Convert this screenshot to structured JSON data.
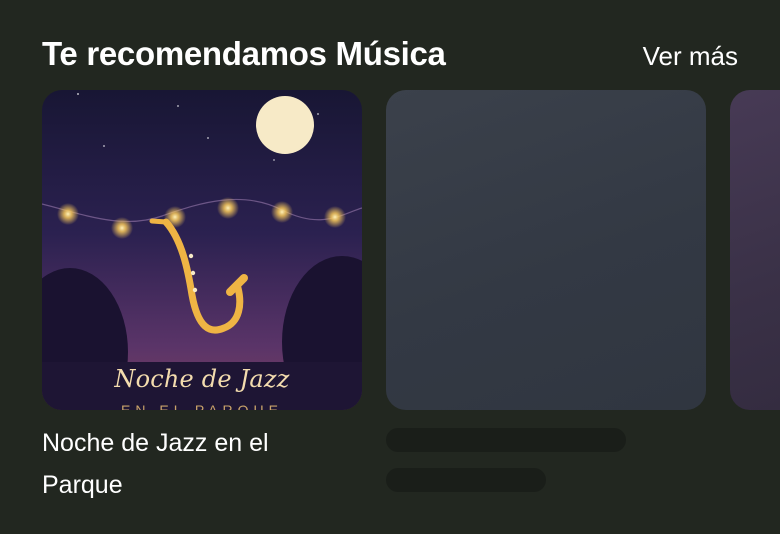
{
  "section": {
    "title": "Te recomendamos Música",
    "see_more_label": "Ver más"
  },
  "cards": [
    {
      "poster_title": "Noche de Jazz",
      "poster_subtitle": "EN EL PARQUE",
      "name": "Noche de Jazz en el Parque",
      "image_icon": "saxophone-icon",
      "loading": false
    },
    {
      "name": "",
      "loading": true
    },
    {
      "name": "",
      "loading": true
    }
  ],
  "colors": {
    "background": "#222720",
    "text": "#ffffff",
    "placeholder": "#363c46",
    "skeleton": "#1a1e19",
    "poster_accent": "#f0b64a"
  }
}
